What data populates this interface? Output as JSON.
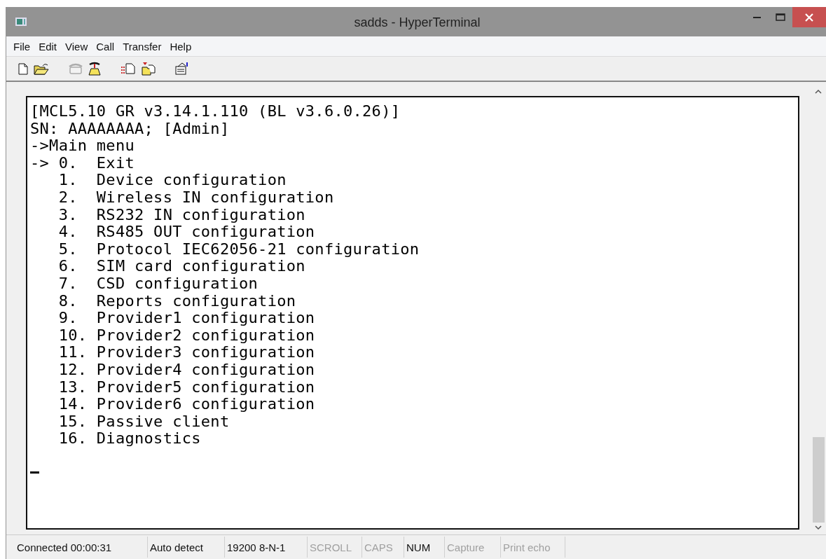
{
  "window": {
    "title": "sadds - HyperTerminal"
  },
  "menu": [
    "File",
    "Edit",
    "View",
    "Call",
    "Transfer",
    "Help"
  ],
  "toolbar": [
    {
      "kind": "new",
      "disabled": false
    },
    {
      "kind": "open",
      "disabled": false
    },
    {
      "kind": "sep"
    },
    {
      "kind": "disconnect",
      "disabled": true
    },
    {
      "kind": "call",
      "disabled": false
    },
    {
      "kind": "sep"
    },
    {
      "kind": "send",
      "disabled": false
    },
    {
      "kind": "receive",
      "disabled": false
    },
    {
      "kind": "sep"
    },
    {
      "kind": "properties",
      "disabled": false
    }
  ],
  "terminal": {
    "lines": [
      "[MCL5.10 GR v3.14.1.110 (BL v3.6.0.26)]",
      "SN: AAAAAAAA; [Admin]",
      "->Main menu",
      "-> 0.  Exit",
      "   1.  Device configuration",
      "   2.  Wireless IN configuration",
      "   3.  RS232 IN configuration",
      "   4.  RS485 OUT configuration",
      "   5.  Protocol IEC62056-21 configuration",
      "   6.  SIM card configuration",
      "   7.  CSD configuration",
      "   8.  Reports configuration",
      "   9.  Provider1 configuration",
      "   10. Provider2 configuration",
      "   11. Provider3 configuration",
      "   12. Provider4 configuration",
      "   13. Provider5 configuration",
      "   14. Provider6 configuration",
      "   15. Passive client",
      "   16. Diagnostics"
    ],
    "cursor": true
  },
  "status_bar": [
    {
      "text": "Connected 00:00:31",
      "disabled": false
    },
    {
      "text": "Auto detect",
      "disabled": false
    },
    {
      "text": "19200 8-N-1",
      "disabled": false
    },
    {
      "text": "SCROLL",
      "disabled": true
    },
    {
      "text": "CAPS",
      "disabled": true
    },
    {
      "text": "NUM",
      "disabled": false
    },
    {
      "text": "Capture",
      "disabled": true
    },
    {
      "text": "Print echo",
      "disabled": true
    }
  ]
}
